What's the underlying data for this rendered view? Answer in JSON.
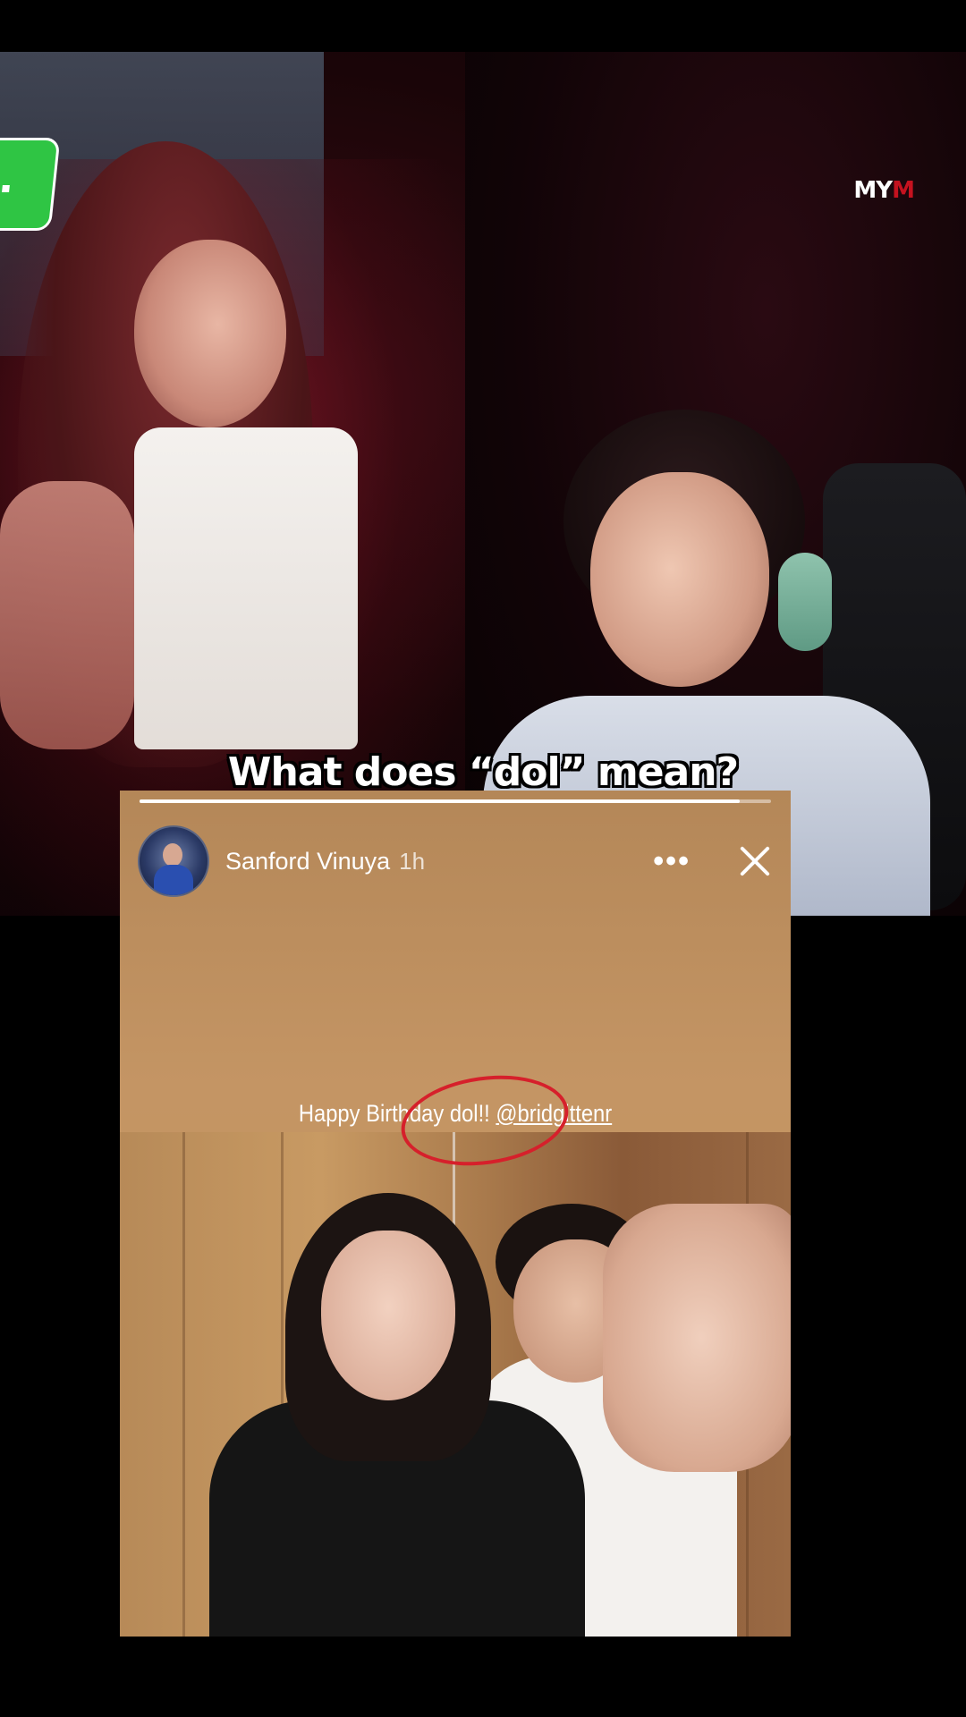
{
  "video": {
    "caption": "What does “dol” mean?",
    "logo": {
      "text_main": "MY",
      "text_accent": "M"
    }
  },
  "story": {
    "username": "Sanford Vinuya",
    "time": "1h",
    "more_label": "•••",
    "text_before": "Happy Birthday dol!! ",
    "mention": "@bridgittenr",
    "progress": 0.95
  },
  "colors": {
    "annotation_circle": "#d6202b",
    "green_tab": "#2fc544"
  },
  "icons": [
    "more-options-icon",
    "close-icon"
  ]
}
